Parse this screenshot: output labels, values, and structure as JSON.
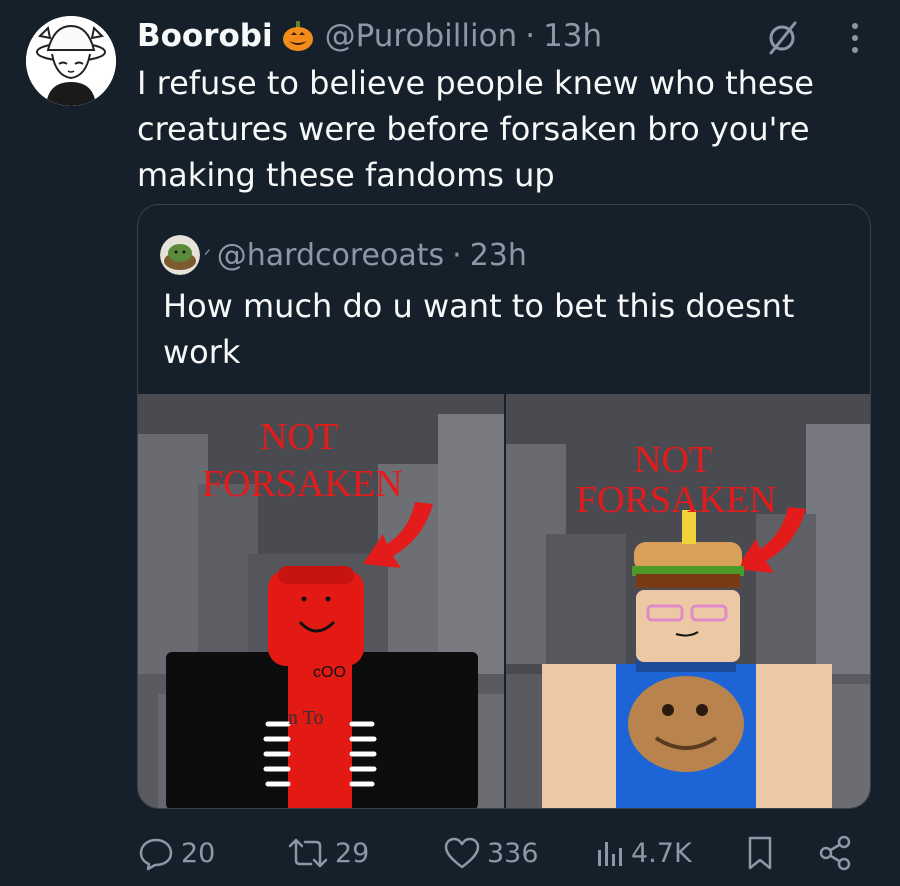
{
  "tweet": {
    "display_name": "Boorobi",
    "name_emoji": "pumpkin-icon",
    "handle": "@Purobillion",
    "separator": "·",
    "time": "13h",
    "text": "I refuse to believe people knew who these creatures were before forsaken bro you're making these fandoms up"
  },
  "quote": {
    "handle": "@hardcoreoats",
    "separator": "·",
    "time": "23h",
    "text": "How much do u want to bet this doesnt work",
    "images": [
      {
        "caption_line1": "NOT",
        "caption_line2": "FORSAKEN",
        "shirt_text1": "cOO",
        "shirt_text2": "n To"
      },
      {
        "caption_line1": "NOT",
        "caption_line2": "FORSAKEN"
      }
    ]
  },
  "actions": {
    "replies": "20",
    "reposts": "29",
    "likes": "336",
    "views": "4.7K"
  },
  "colors": {
    "background": "#15202b",
    "text": "#f7f9f9",
    "secondary": "#8b98a5",
    "border": "#38444d",
    "caption_red": "#e41b1b"
  }
}
